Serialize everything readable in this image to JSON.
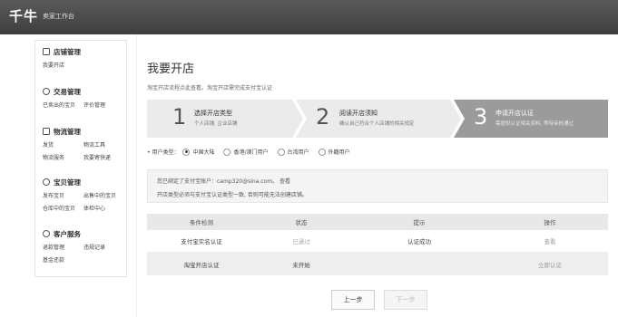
{
  "app": {
    "logo": "千牛",
    "subtitle": "卖家工作台"
  },
  "sidebar": {
    "sections": [
      {
        "title": "店铺管理",
        "icon": "store-icon",
        "items": [
          "我要开店"
        ]
      },
      {
        "title": "交易管理",
        "icon": "trade-icon",
        "items": [
          "已卖出的宝贝",
          "评价管理"
        ]
      },
      {
        "title": "物流管理",
        "icon": "logistics-icon",
        "items": [
          "发货",
          "物流工具",
          "物流服务",
          "我要寄快递"
        ]
      },
      {
        "title": "宝贝管理",
        "icon": "goods-icon",
        "items": [
          "发布宝贝",
          "出售中的宝贝",
          "仓库中的宝贝",
          "体检中心"
        ]
      },
      {
        "title": "客户服务",
        "icon": "service-icon",
        "items": [
          "退款管理",
          "违规记录",
          "基金还款"
        ]
      }
    ]
  },
  "main": {
    "title": "我要开店",
    "hint": "淘宝开店流程点此查看。淘宝开店需完成支付宝认证",
    "steps": [
      {
        "num": "1",
        "title": "选择开店类型",
        "desc": "个人店铺, 企业店铺"
      },
      {
        "num": "2",
        "title": "阅读开店须知",
        "desc": "确认自己符合个人店铺的相关规定"
      },
      {
        "num": "3",
        "title": "申请开店认证",
        "desc": "需提供认证相关资料, 等待审核通过"
      }
    ],
    "user_type": {
      "label": "• 用户类型：",
      "options": [
        "中国大陆",
        "香港/澳门用户",
        "台湾用户",
        "外籍用户"
      ],
      "selected": "中国大陆"
    },
    "notice": {
      "line1": "您已绑定了支付宝账户：camp320@sina.com。 查看",
      "line2": "开店类型必须与支付宝认证类型一致, 否则可能无法创建店铺。"
    },
    "table": {
      "headers": [
        "条件检测",
        "状态",
        "提示",
        "操作"
      ],
      "rows": [
        {
          "condition": "支付宝实名认证",
          "status": "已通过",
          "tip": "认证成功",
          "action": "查看"
        },
        {
          "condition": "淘宝开店认证",
          "status": "未开始",
          "tip": "",
          "action": "立即认证"
        }
      ]
    },
    "buttons": {
      "prev": "上一步",
      "next": "下一步"
    }
  },
  "colors": {
    "topbar": "#4a4a4a",
    "step_active": "#9b9b9b",
    "step_inactive": "#ebebeb"
  }
}
